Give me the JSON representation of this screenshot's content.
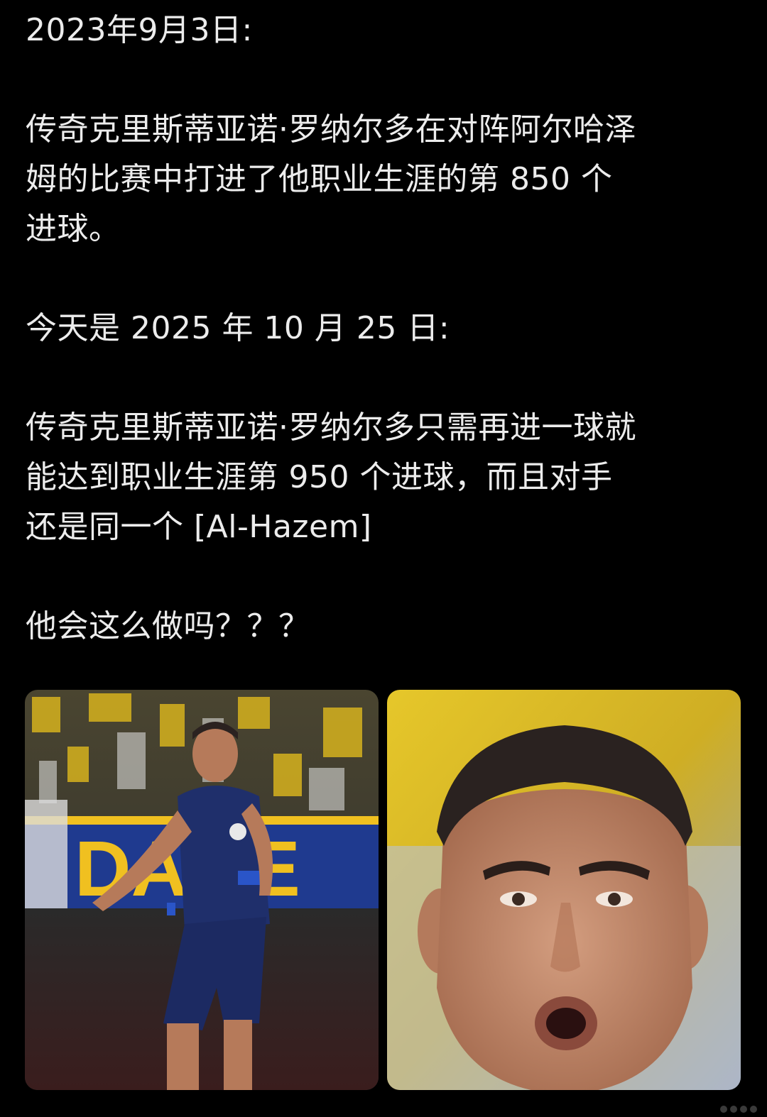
{
  "post": {
    "paragraphs": [
      "2023年9月3日:",
      "传奇克里斯蒂亚诺·罗纳尔多在对阵阿尔哈泽\n姆的比赛中打进了他职业生涯的第 850 个\n进球。",
      "今天是 2025 年 10 月 25 日:",
      "传奇克里斯蒂亚诺·罗纳尔多只需再进一球就\n能达到职业生涯第 950 个进球，而且对手\n还是同一个 [Al-Hazem]",
      "他会这么做吗？？？"
    ]
  },
  "media": {
    "left_photo": {
      "subject": "player-celebration-photo",
      "banner_text": "DAGE"
    },
    "right_photo": {
      "subject": "player-closeup-photo"
    }
  },
  "colors": {
    "background": "#000000",
    "text": "#ececec",
    "jersey": "#1f2f6b",
    "banner_yellow": "#f0c020"
  }
}
